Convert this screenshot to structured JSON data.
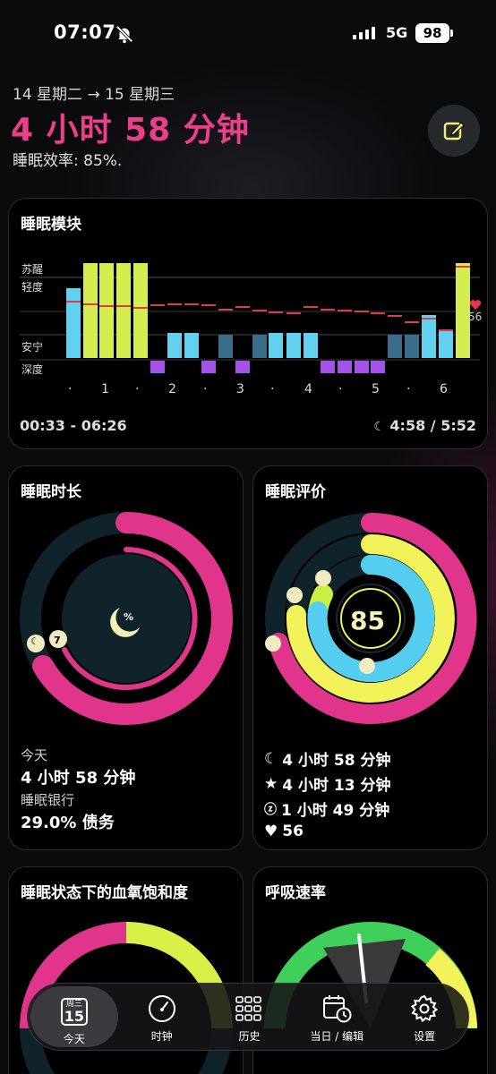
{
  "status_bar": {
    "time": "07:07",
    "network": "5G",
    "battery": "98"
  },
  "header": {
    "date_range": "14 星期二 → 15 星期三",
    "duration": "4 小时 58 分钟",
    "efficiency": "睡眠效率: 85%."
  },
  "modules_card": {
    "title": "睡眠模块",
    "stage_labels": [
      "苏醒",
      "轻度",
      "安宁",
      "深度"
    ],
    "x_ticks": [
      "1",
      "2",
      "3",
      "4",
      "5",
      "6"
    ],
    "time_range": "00:33 - 06:26",
    "sleep_ratio": "4:58 / 5:52",
    "heart_rate_value": "56",
    "colors": {
      "awake": "#d4ee4f",
      "light": "#62d0ef",
      "restful": "#3a6d8c",
      "deep": "#a552e8",
      "hr_line": "#e03a4e"
    }
  },
  "duration_card": {
    "title": "睡眠时长",
    "ring_icon_label": "%",
    "today_label": "今天",
    "today_value": "4 小时 58 分钟",
    "bank_label": "睡眠银行",
    "bank_value": "29.0% 债务"
  },
  "score_card": {
    "title": "睡眠评价",
    "score": "85",
    "stats": [
      {
        "icon": "moon-icon",
        "text": "4 小时 58 分钟"
      },
      {
        "icon": "star-icon",
        "text": "4 小时 13 分钟"
      },
      {
        "icon": "zz-icon",
        "text": "1 小时 49 分钟"
      },
      {
        "icon": "heart-icon",
        "text": "56"
      }
    ]
  },
  "spo2_card": {
    "title": "睡眠状态下的血氧饱和度"
  },
  "resp_card": {
    "title": "呼吸速率"
  },
  "tab_bar": {
    "calendar_weekday": "周三",
    "calendar_day": "15",
    "tabs": [
      {
        "label": "今天",
        "icon": "calendar-icon"
      },
      {
        "label": "时钟",
        "icon": "gauge-icon"
      },
      {
        "label": "历史",
        "icon": "grid-icon"
      },
      {
        "label": "当日 / 编辑",
        "icon": "calendar-clock-icon"
      },
      {
        "label": "设置",
        "icon": "gear-icon"
      }
    ]
  },
  "accent_colors": {
    "pink": "#e0358a",
    "yellow": "#f2f25a",
    "cyan": "#55cdf0",
    "ring_track": "#13262c"
  }
}
